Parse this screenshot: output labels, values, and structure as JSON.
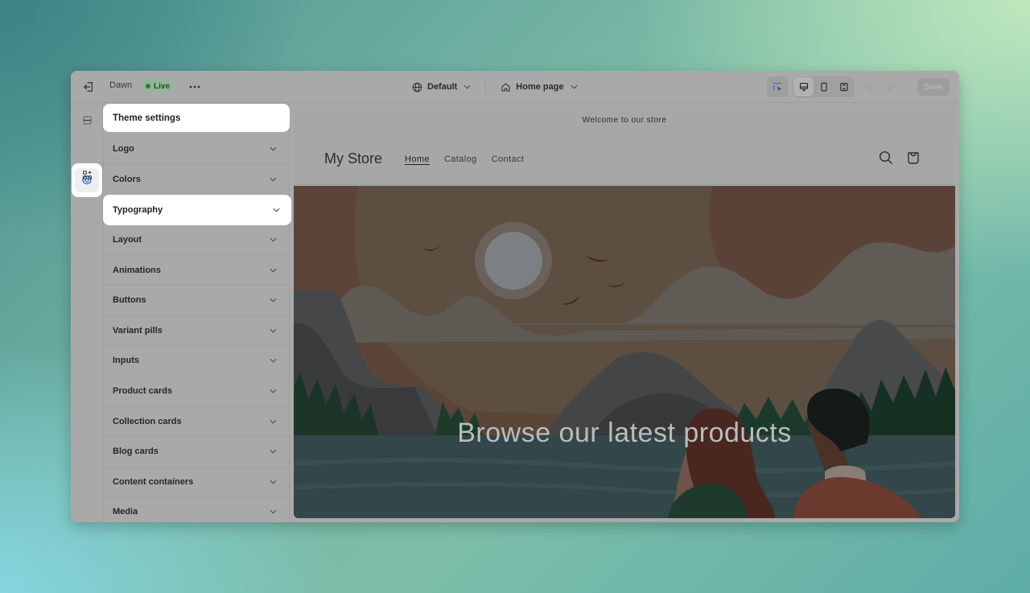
{
  "topbar": {
    "exit_icon": "exit-icon",
    "theme_name": "Dawn",
    "status_badge": "Live",
    "more_label": "•••",
    "language_selector": {
      "icon": "globe-icon",
      "label": "Default"
    },
    "page_selector": {
      "icon": "home-icon",
      "label": "Home page"
    },
    "inspector_icon": "inspector-icon",
    "device_buttons": [
      {
        "name": "desktop",
        "icon": "desktop-icon",
        "active": true
      },
      {
        "name": "mobile",
        "icon": "mobile-icon",
        "active": false
      },
      {
        "name": "fullscreen",
        "icon": "fullscreen-icon",
        "active": false
      }
    ],
    "undo_icon": "undo-icon",
    "redo_icon": "redo-icon",
    "save_label": "Save"
  },
  "rail": {
    "items": [
      {
        "name": "sections",
        "icon": "sections-icon"
      },
      {
        "name": "theme-settings",
        "icon": "gear-icon",
        "active": true
      },
      {
        "name": "apps",
        "icon": "apps-icon"
      }
    ]
  },
  "panel": {
    "title": "Theme settings",
    "items": [
      {
        "label": "Logo"
      },
      {
        "label": "Colors"
      },
      {
        "label": "Typography",
        "highlighted": true
      },
      {
        "label": "Layout"
      },
      {
        "label": "Animations"
      },
      {
        "label": "Buttons"
      },
      {
        "label": "Variant pills"
      },
      {
        "label": "Inputs"
      },
      {
        "label": "Product cards"
      },
      {
        "label": "Collection cards"
      },
      {
        "label": "Blog cards"
      },
      {
        "label": "Content containers"
      },
      {
        "label": "Media"
      }
    ]
  },
  "preview": {
    "announcement": "Welcome to our store",
    "store_name": "My Store",
    "nav": [
      {
        "label": "Home",
        "active": true
      },
      {
        "label": "Catalog"
      },
      {
        "label": "Contact"
      }
    ],
    "hero_title": "Browse our latest products"
  },
  "colors": {
    "accent": "#2c6ecb",
    "live_dot": "#2f7a3c"
  }
}
